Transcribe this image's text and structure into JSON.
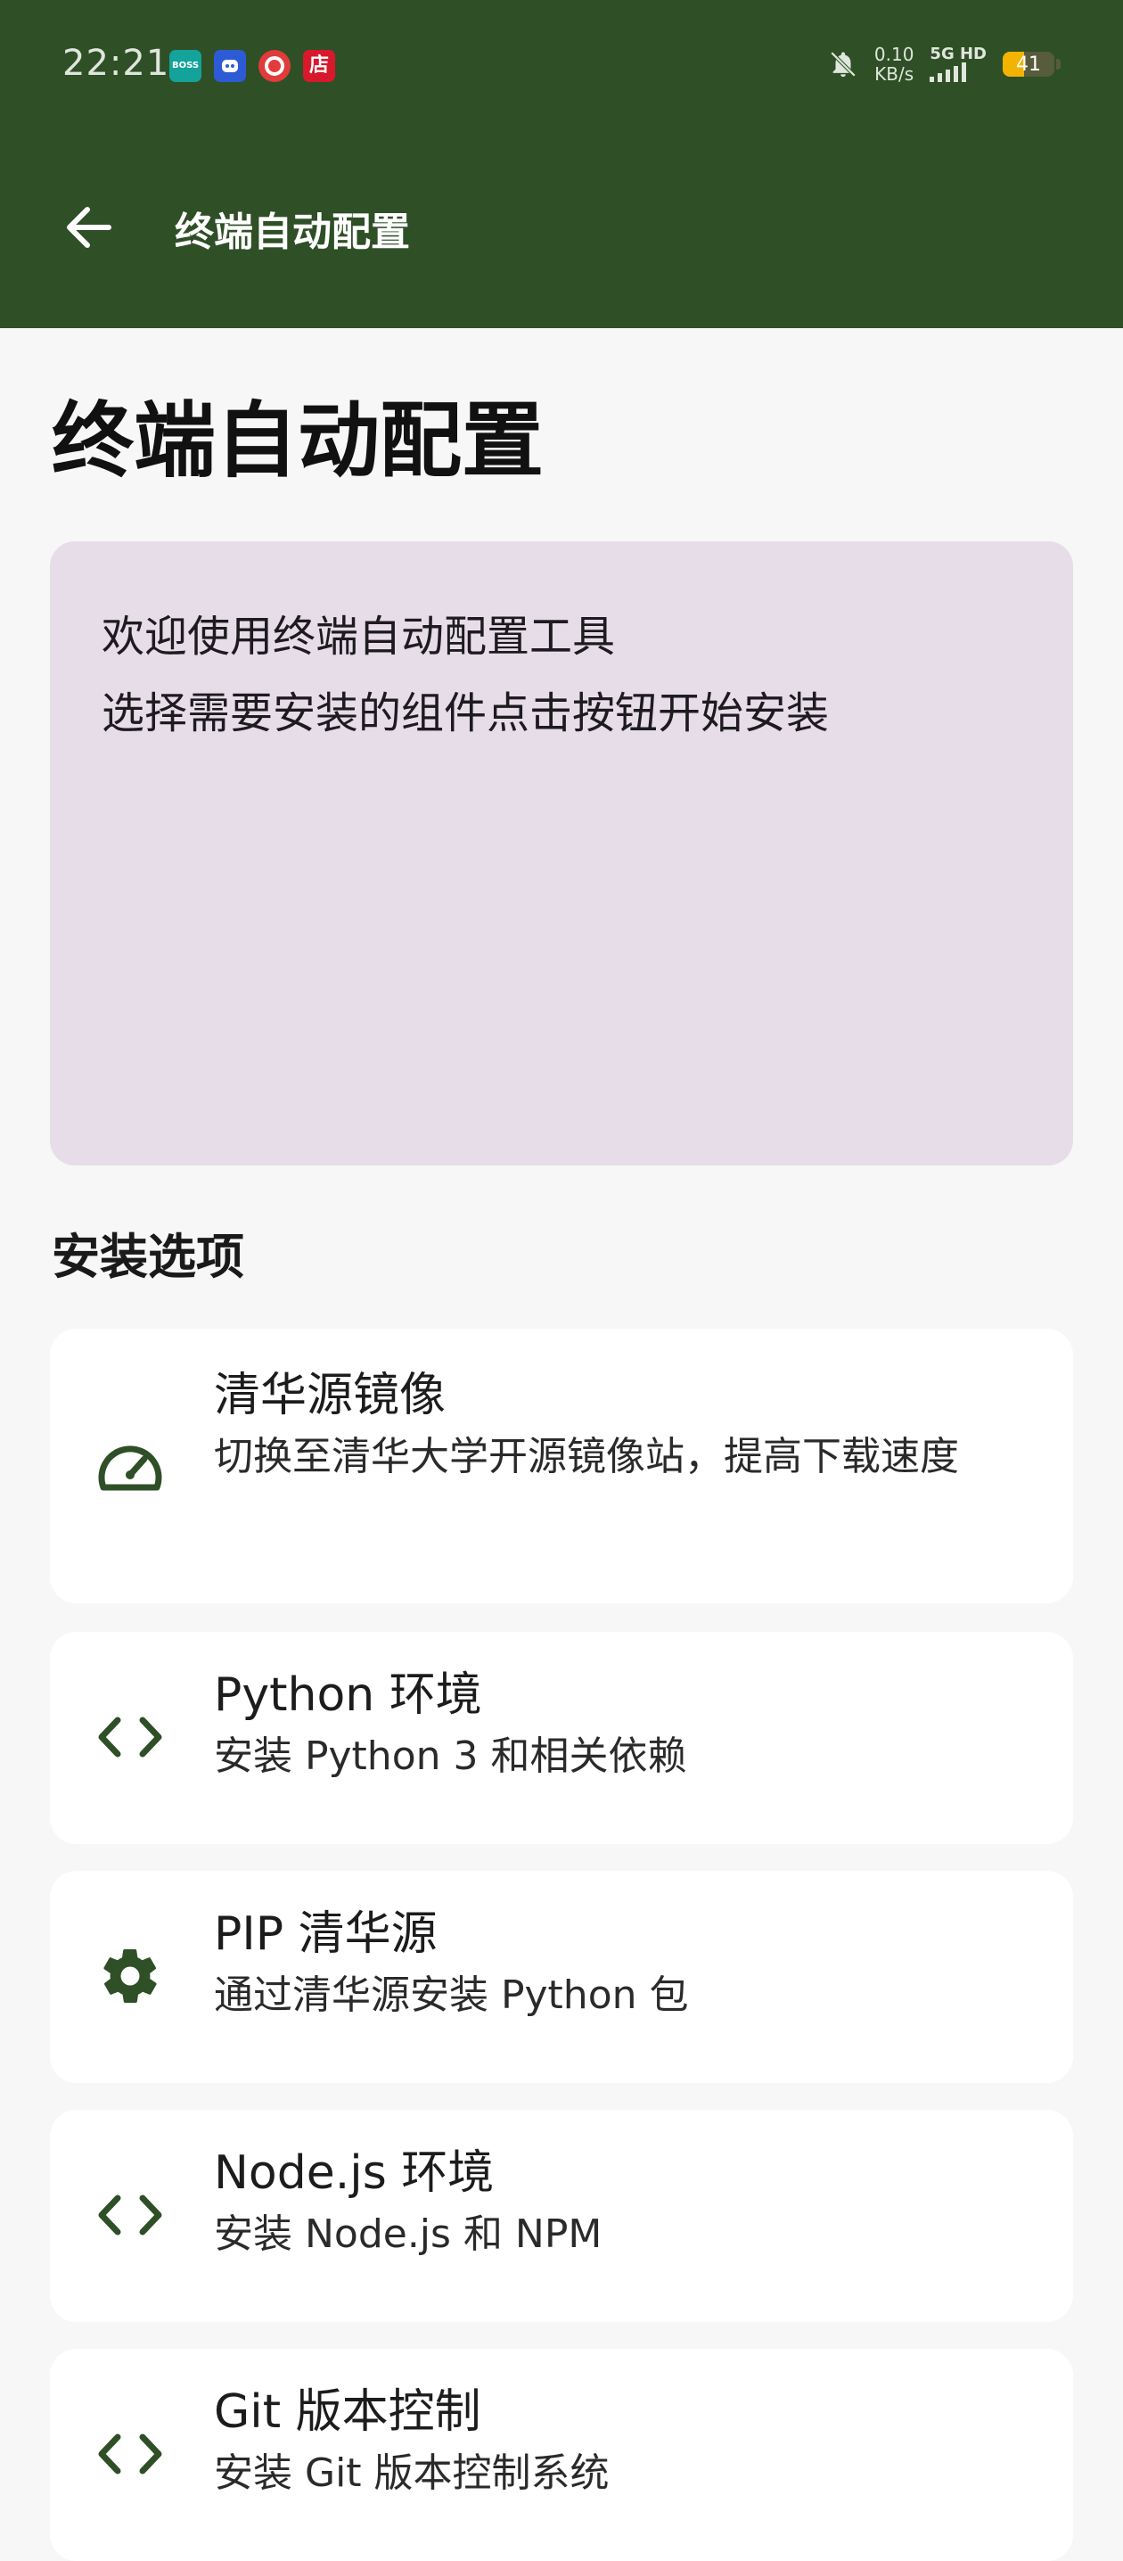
{
  "status_bar": {
    "time": "22:21",
    "notifications": [
      {
        "name": "boss-app-icon",
        "label": "BOSS\n直聘"
      },
      {
        "name": "robot-app-icon",
        "label": ""
      },
      {
        "name": "red-app-icon",
        "label": ""
      },
      {
        "name": "store-app-icon",
        "label": "店"
      }
    ],
    "net_speed_value": "0.10",
    "net_speed_unit": "KB/s",
    "signal_label": "5G HD",
    "battery_level": 41,
    "battery_text": "41",
    "colors": {
      "battery": "#f2b400"
    }
  },
  "app_bar": {
    "title": "终端自动配置",
    "back_icon": "arrow-left-icon",
    "color": "#2f4f27"
  },
  "main": {
    "page_title": "终端自动配置",
    "welcome": {
      "line1": "欢迎使用终端自动配置工具",
      "line2": "选择需要安装的组件点击按钮开始安装"
    },
    "section_title": "安装选项",
    "options": [
      {
        "icon": "speedometer-icon",
        "title": "清华源镜像",
        "desc": "切换至清华大学开源镜像站，提高下载速度"
      },
      {
        "icon": "code-icon",
        "title": "Python 环境",
        "desc": "安装 Python 3 和相关依赖"
      },
      {
        "icon": "gear-icon",
        "title": "PIP 清华源",
        "desc": "通过清华源安装 Python 包"
      },
      {
        "icon": "code-icon",
        "title": "Node.js 环境",
        "desc": "安装 Node.js 和 NPM"
      },
      {
        "icon": "code-icon",
        "title": "Git 版本控制",
        "desc": "安装 Git 版本控制系统"
      }
    ]
  }
}
